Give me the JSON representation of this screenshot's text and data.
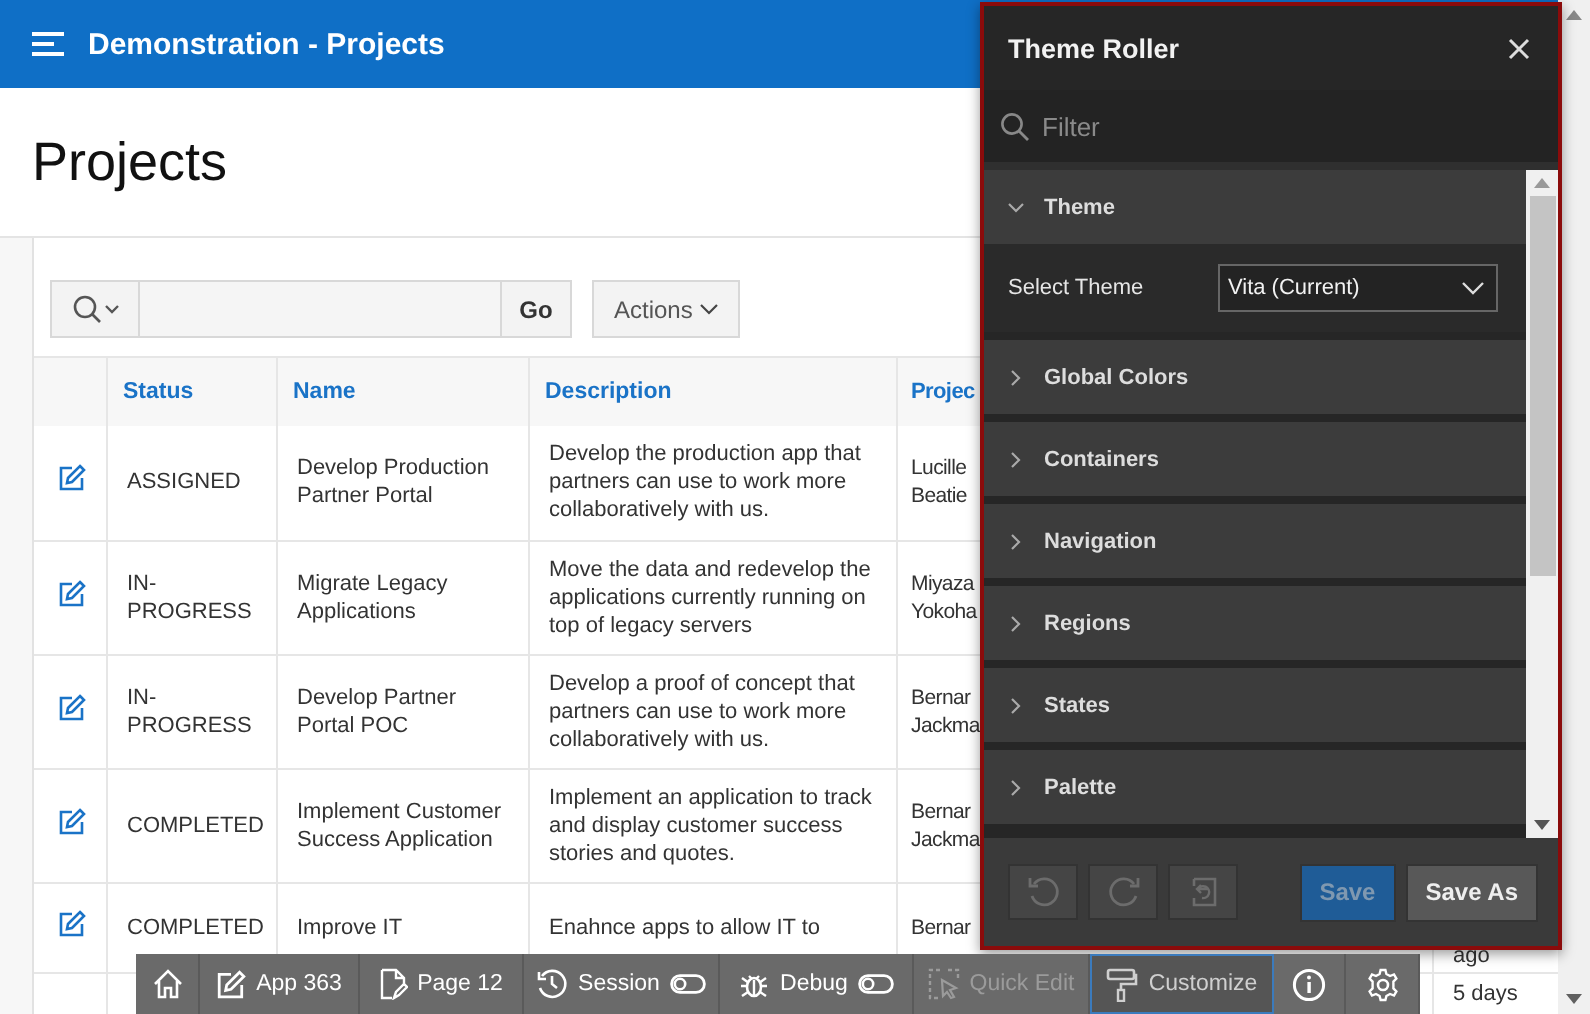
{
  "app_header": {
    "title": "Demonstration - Projects"
  },
  "page": {
    "title": "Projects"
  },
  "report": {
    "go_button": "Go",
    "actions_button": "Actions",
    "columns": [
      "Status",
      "Name",
      "Description",
      "Projec"
    ],
    "rows": [
      {
        "status": "ASSIGNED",
        "name": "Develop Production Partner Portal",
        "description": "Develop the production app that partners can use to work more collaboratively with us.",
        "project": "Lucille Beatie"
      },
      {
        "status": "IN-PROGRESS",
        "name": "Migrate Legacy Applications",
        "description": "Move the data and redevelop the applications currently running on top of legacy servers",
        "project": "Miyaza Yokoha"
      },
      {
        "status": "IN-PROGRESS",
        "name": "Develop Partner Portal POC",
        "description": "Develop a proof of concept that partners can use to work more collaboratively with us.",
        "project": "Bernar Jackma"
      },
      {
        "status": "COMPLETED",
        "name": "Implement Customer Success Application",
        "description": "Implement an application to track and display customer success stories and quotes.",
        "project": "Bernar Jackma"
      },
      {
        "status": "COMPLETED",
        "name": "Improve IT",
        "description": "Enahnce apps to allow IT to",
        "project": "Bernar",
        "column_5": "ago"
      },
      {
        "column_5": "5 days"
      }
    ]
  },
  "theme_roller": {
    "title": "Theme Roller",
    "filter": {
      "placeholder": "Filter"
    },
    "sections": [
      {
        "label": "Theme",
        "expanded": true,
        "select_label": "Select Theme",
        "select_value": "Vita (Current)"
      },
      {
        "label": "Global Colors",
        "expanded": false
      },
      {
        "label": "Containers",
        "expanded": false
      },
      {
        "label": "Navigation",
        "expanded": false
      },
      {
        "label": "Regions",
        "expanded": false
      },
      {
        "label": "States",
        "expanded": false
      },
      {
        "label": "Palette",
        "expanded": false
      }
    ],
    "icon_buttons": [
      {
        "kind": "undo",
        "disabled": true
      },
      {
        "kind": "redo",
        "disabled": true
      },
      {
        "kind": "reset",
        "disabled": true
      }
    ],
    "buttons": [
      {
        "label": "Save",
        "kind": "primary",
        "disabled": true
      },
      {
        "label": "Save As",
        "kind": "normal",
        "disabled": false
      }
    ]
  },
  "dev_toolbar": [
    {
      "kind": "home",
      "selected": false,
      "disabled": false
    },
    {
      "kind": "app",
      "label": "App 363",
      "selected": false,
      "disabled": false
    },
    {
      "kind": "page",
      "label": "Page 12",
      "selected": false,
      "disabled": false
    },
    {
      "kind": "session",
      "label": "Session",
      "selected": false,
      "disabled": false
    },
    {
      "kind": "debug",
      "label": "Debug",
      "selected": false,
      "disabled": false
    },
    {
      "kind": "quick_edit",
      "label": "Quick Edit",
      "selected": false,
      "disabled": true
    },
    {
      "kind": "customize",
      "label": "Customize",
      "selected": true,
      "disabled": false
    },
    {
      "kind": "info",
      "selected": false,
      "disabled": false
    },
    {
      "kind": "settings",
      "selected": false,
      "disabled": false
    }
  ]
}
